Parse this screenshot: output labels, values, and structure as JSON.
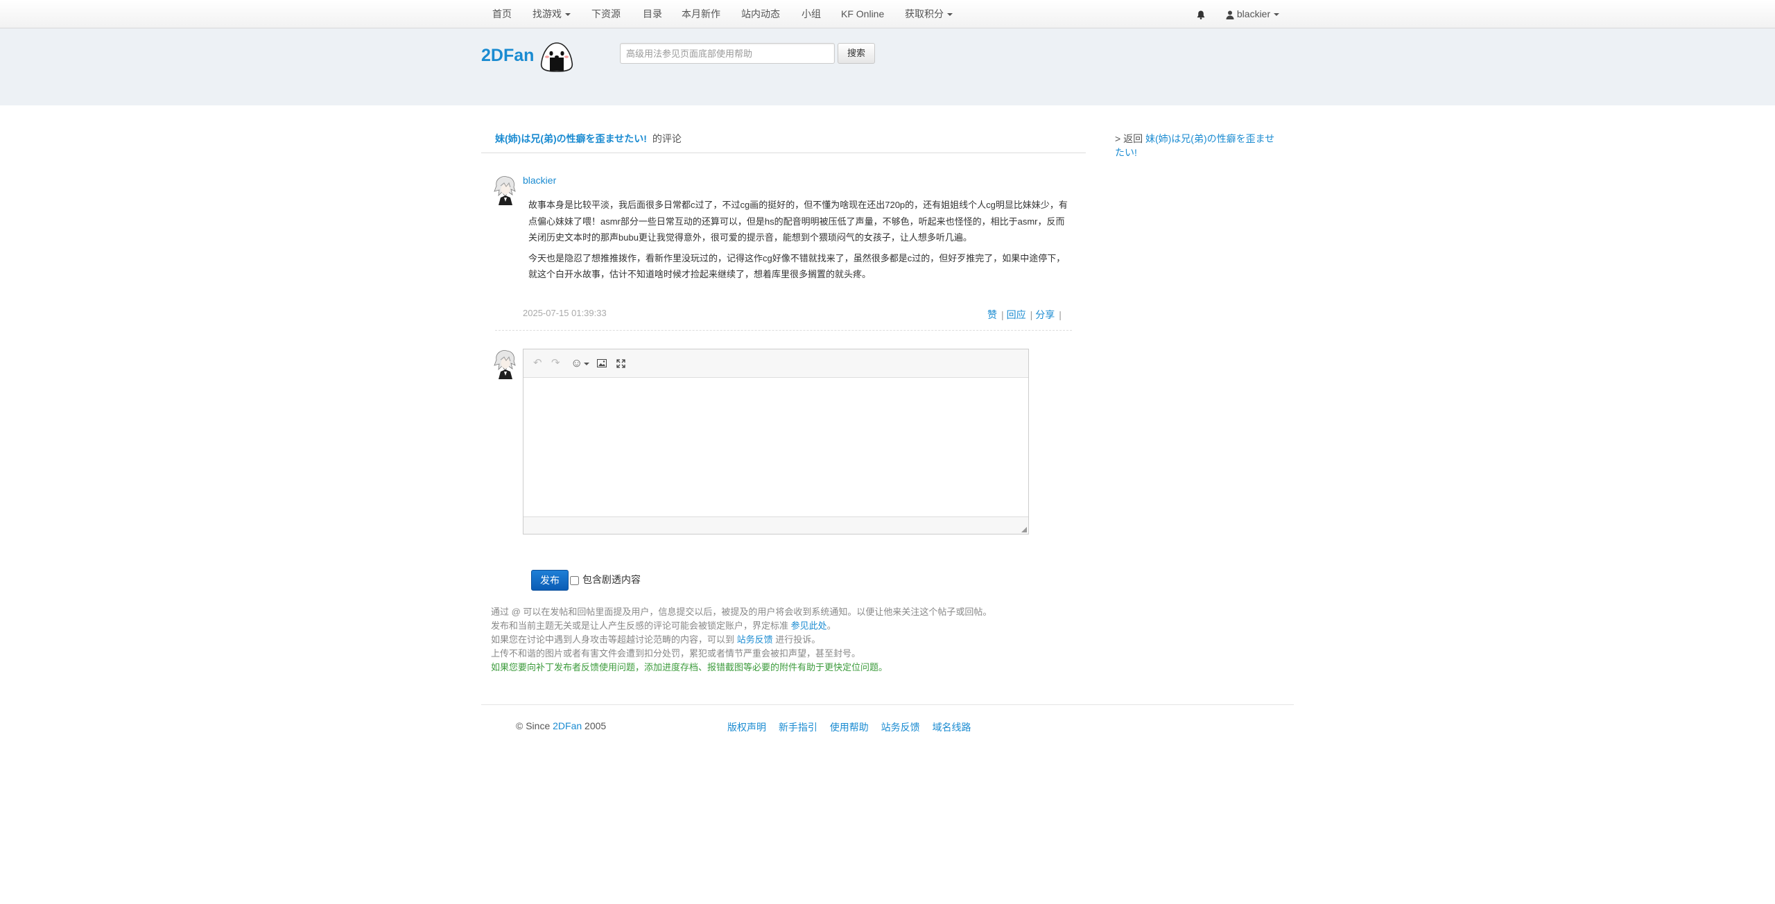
{
  "nav": {
    "items": [
      {
        "label": "首页"
      },
      {
        "label": "找游戏"
      },
      {
        "label": "下资源"
      },
      {
        "label": "目录"
      },
      {
        "label": "本月新作"
      },
      {
        "label": "站内动态"
      },
      {
        "label": "小组"
      },
      {
        "label": "KF Online"
      },
      {
        "label": "获取积分"
      }
    ],
    "user": "blackier"
  },
  "header": {
    "logo": "2DFan",
    "search_placeholder": "高级用法参见页面底部使用帮助",
    "search_button": "搜索"
  },
  "breadcrumb": {
    "title": "妹(姉)は兄(弟)の性癖を歪ませたい!",
    "suffix": "的评论"
  },
  "sidebar": {
    "prefix": "> 返回",
    "link": "妹(姉)は兄(弟)の性癖を歪ませたい!"
  },
  "comment": {
    "user": "blackier",
    "paragraphs": [
      "故事本身是比较平淡，我后面很多日常都c过了，不过cg画的挺好的，但不懂为啥现在还出720p的，还有姐姐线个人cg明显比妹妹少，有点偏心妹妹了喂！asmr部分一些日常互动的还算可以，但是hs的配音明明被压低了声量，不够色，听起来也怪怪的，相比于asmr，反而关闭历史文本时的那声bubu更让我觉得意外，很可爱的提示音，能想到个猥琐闷气的女孩子，让人想多听几遍。",
      "今天也是隐忍了想推推拨作，看新作里没玩过的，记得这作cg好像不错就找来了，虽然很多都是c过的，但好歹推完了，如果中途停下，就这个白开水故事，估计不知道啥时候才捡起来继续了，想着库里很多搁置的就头疼。"
    ],
    "time": "2025-07-15 01:39:33",
    "actions": [
      "赞",
      "回应",
      "分享"
    ]
  },
  "editor": {
    "toolbar": [
      "undo-icon",
      "redo-icon",
      "emoji-icon",
      "image-icon",
      "fullscreen-icon"
    ]
  },
  "form": {
    "publish": "发布",
    "spoiler": "包含剧透内容"
  },
  "notes": {
    "line1": "通过 @ 可以在发帖和回帖里面提及用户，信息提交以后，被提及的用户将会收到系统通知。以便让他来关注这个帖子或回帖。",
    "line2_a": "发布和当前主题无关或是让人产生反感的评论可能会被锁定账户，界定标准",
    "line2_link": "参见此处",
    "line2_b": "。",
    "line3_a": "如果您在讨论中遇到人身攻击等超越讨论范畴的内容，可以到",
    "line3_link": "站务反馈",
    "line3_b": "进行投诉。",
    "line4": "上传不和谐的图片或者有害文件会遭到扣分处罚，累犯或者情节严重会被扣声望，甚至封号。",
    "line5": "如果您要向补丁发布者反馈使用问题，添加进度存档、报错截图等必要的附件有助于更快定位问题。"
  },
  "footer": {
    "copy_prefix": "© Since",
    "copy_link": "2DFan",
    "copy_year": "2005",
    "links": [
      "版权声明",
      "新手指引",
      "使用帮助",
      "站务反馈",
      "域名线路"
    ]
  }
}
